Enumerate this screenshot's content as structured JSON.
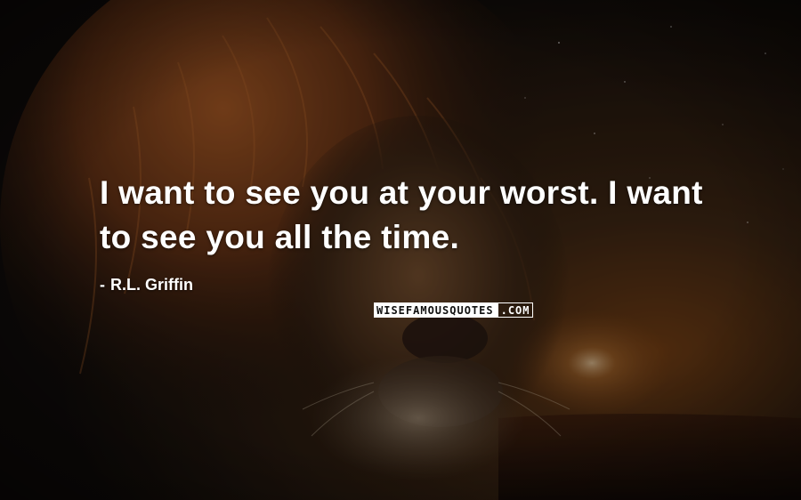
{
  "quote": {
    "text": "I want to see you at your worst. I want to see you all the time."
  },
  "attribution": {
    "dash": "-",
    "author": "R.L. Griffin"
  },
  "watermark": {
    "left_text": "WISEFAMOUSQUOTES",
    "right_text": ".COM"
  },
  "colors": {
    "text": "#ffffff",
    "background_dark": "#120d0a",
    "mane_orange": "#8a4a1c",
    "glow_orange": "#b5601e"
  },
  "background": {
    "subject": "lion-face"
  }
}
